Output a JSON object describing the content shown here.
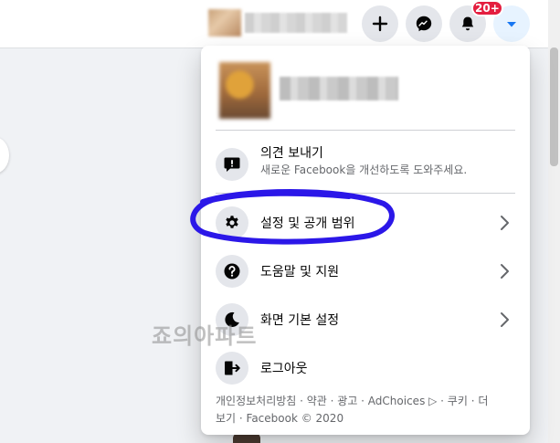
{
  "header": {
    "badge_count": "20+"
  },
  "menu": {
    "items": [
      {
        "label": "의견 보내기",
        "description": "새로운 Facebook을 개선하도록 도와주세요.",
        "icon": "feedback-icon"
      },
      {
        "label": "설정 및 공개 범위",
        "icon": "gear-icon",
        "has_chevron": true
      },
      {
        "label": "도움말 및 지원",
        "icon": "help-icon",
        "has_chevron": true
      },
      {
        "label": "화면 기본 설정",
        "icon": "moon-icon",
        "has_chevron": true
      },
      {
        "label": "로그아웃",
        "icon": "logout-icon"
      }
    ],
    "footer_line1": "개인정보처리방침 · 약관 · 광고 · AdChoices ▷ · 쿠키 · 더",
    "footer_line2": "보기 · Facebook © 2020"
  },
  "overlay": {
    "watermark": "죠의아파트",
    "annotation_color": "#2b17e8"
  },
  "colors": {
    "accent": "#1877f2",
    "badge": "#e41e3f",
    "icon_bg": "#e4e6eb"
  }
}
